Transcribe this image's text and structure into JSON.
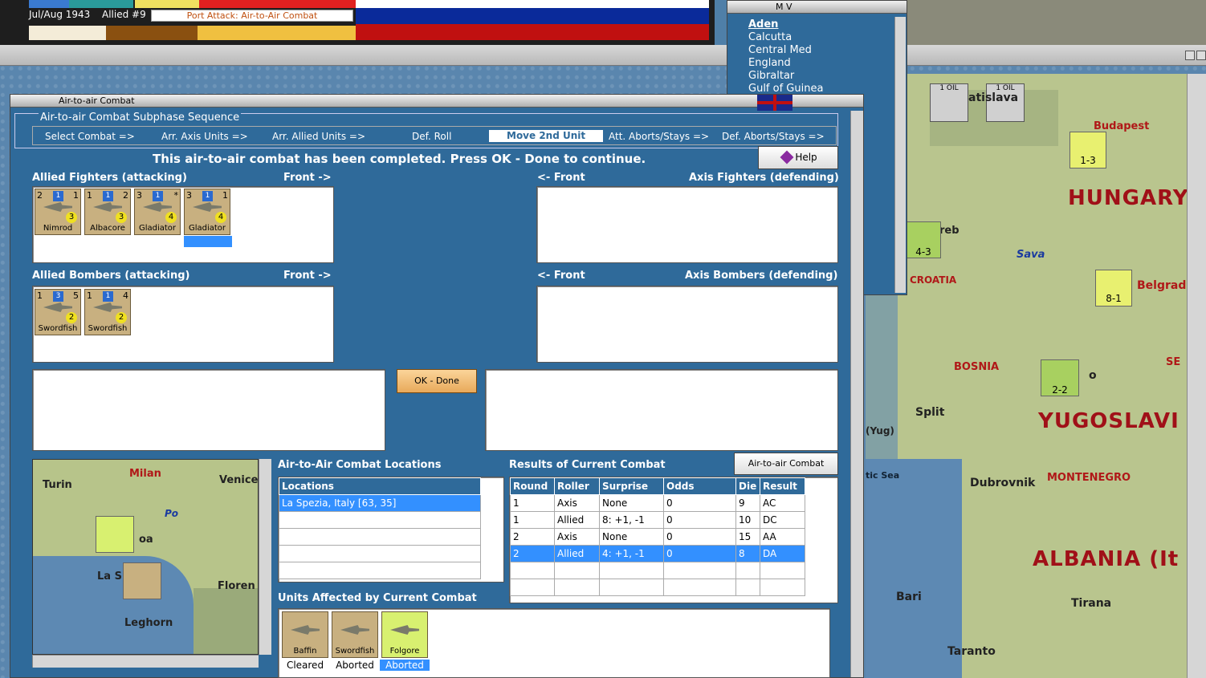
{
  "topbar": {
    "date": "Jul/Aug 1943",
    "allied": "Allied #9",
    "phase": "Port Attack: Air-to-Air Combat"
  },
  "mv_window": {
    "title": "M V",
    "items": [
      "Aden",
      "Calcutta",
      "Central Med",
      "England",
      "Gibraltar",
      "Gulf of Guinea"
    ]
  },
  "dialog": {
    "title": "Air-to-air Combat",
    "sequence_title": "Air-to-air Combat Subphase Sequence",
    "steps": [
      "Select Combat =>",
      "Arr. Axis Units =>",
      "Arr. Allied Units =>",
      "Def. Roll",
      "Move 2nd Unit",
      "Att. Aborts/Stays =>",
      "Def. Aborts/Stays =>"
    ],
    "message": "This air-to-air combat has been completed.  Press OK - Done to continue.",
    "help": "Help",
    "allied_fighters_label": "Allied Fighters (attacking)",
    "front_right": "Front ->",
    "front_left": "<- Front",
    "axis_fighters_label": "Axis Fighters (defending)",
    "allied_bombers_label": "Allied Bombers (attacking)",
    "axis_bombers_label": "Axis Bombers (defending)",
    "ok_done": "OK - Done",
    "allied_fighters": [
      {
        "name": "Nimrod",
        "tl": "2",
        "tr": "1",
        "badge": "1",
        "val": "3"
      },
      {
        "name": "Albacore",
        "tl": "1",
        "tr": "2",
        "badge": "1",
        "val": "3"
      },
      {
        "name": "Gladiator",
        "tl": "3",
        "tr": "*",
        "badge": "1",
        "val": "4"
      },
      {
        "name": "Gladiator",
        "tl": "3",
        "tr": "1",
        "badge": "1",
        "val": "4"
      }
    ],
    "allied_bombers": [
      {
        "name": "Swordfish",
        "tl": "1",
        "tr": "5",
        "badge": "3",
        "val": "2",
        "prefix": "2"
      },
      {
        "name": "Swordfish",
        "tl": "1",
        "tr": "4",
        "badge": "1",
        "val": "2",
        "prefix": "1"
      }
    ],
    "locations_title": "Air-to-Air Combat Locations",
    "locations_header": "Locations",
    "locations": [
      "La Spezia, Italy [63, 35]"
    ],
    "results_title": "Results of Current Combat",
    "chart_button": "Air-to-air Combat Chart",
    "results_headers": [
      "Round",
      "Roller",
      "Surprise",
      "Odds",
      "Die",
      "Result"
    ],
    "results": [
      [
        "1",
        "Axis",
        "None",
        "0",
        "9",
        "AC"
      ],
      [
        "1",
        "Allied",
        "8: +1, -1",
        "0",
        "10",
        "DC"
      ],
      [
        "2",
        "Axis",
        "None",
        "0",
        "15",
        "AA"
      ],
      [
        "2",
        "Allied",
        "4: +1, -1",
        "0",
        "8",
        "DA"
      ]
    ],
    "units_title": "Units Affected by Current Combat",
    "affected": [
      {
        "name": "Baffin",
        "status": "Cleared"
      },
      {
        "name": "Swordfish",
        "status": "Aborted"
      },
      {
        "name": "Folgore",
        "status": "Aborted"
      }
    ],
    "minimap": {
      "cities": [
        "Turin",
        "Milan",
        "Venice",
        "Po",
        "La S",
        "Floren",
        "Leghorn",
        "oa"
      ]
    }
  },
  "map": {
    "labels": [
      "atislava",
      "Budapest",
      "HUNGARY",
      "Sava",
      "CROATIA",
      "Belgrad",
      "BOSNIA",
      "Split",
      "(Yug)",
      "YUGOSLAVI",
      "Dubrovnik",
      "MONTENEGRO",
      "ALBANIA (It",
      "Bari",
      "Tirana",
      "Taranto",
      "tic Sea",
      "SE",
      "reb",
      "o"
    ],
    "oil": "1 OIL",
    "counters": [
      "1-3",
      "4-3",
      "8-1",
      "2-2"
    ]
  },
  "colors": {
    "dialog": "#2f6a9a",
    "accent": "#3390ff"
  }
}
